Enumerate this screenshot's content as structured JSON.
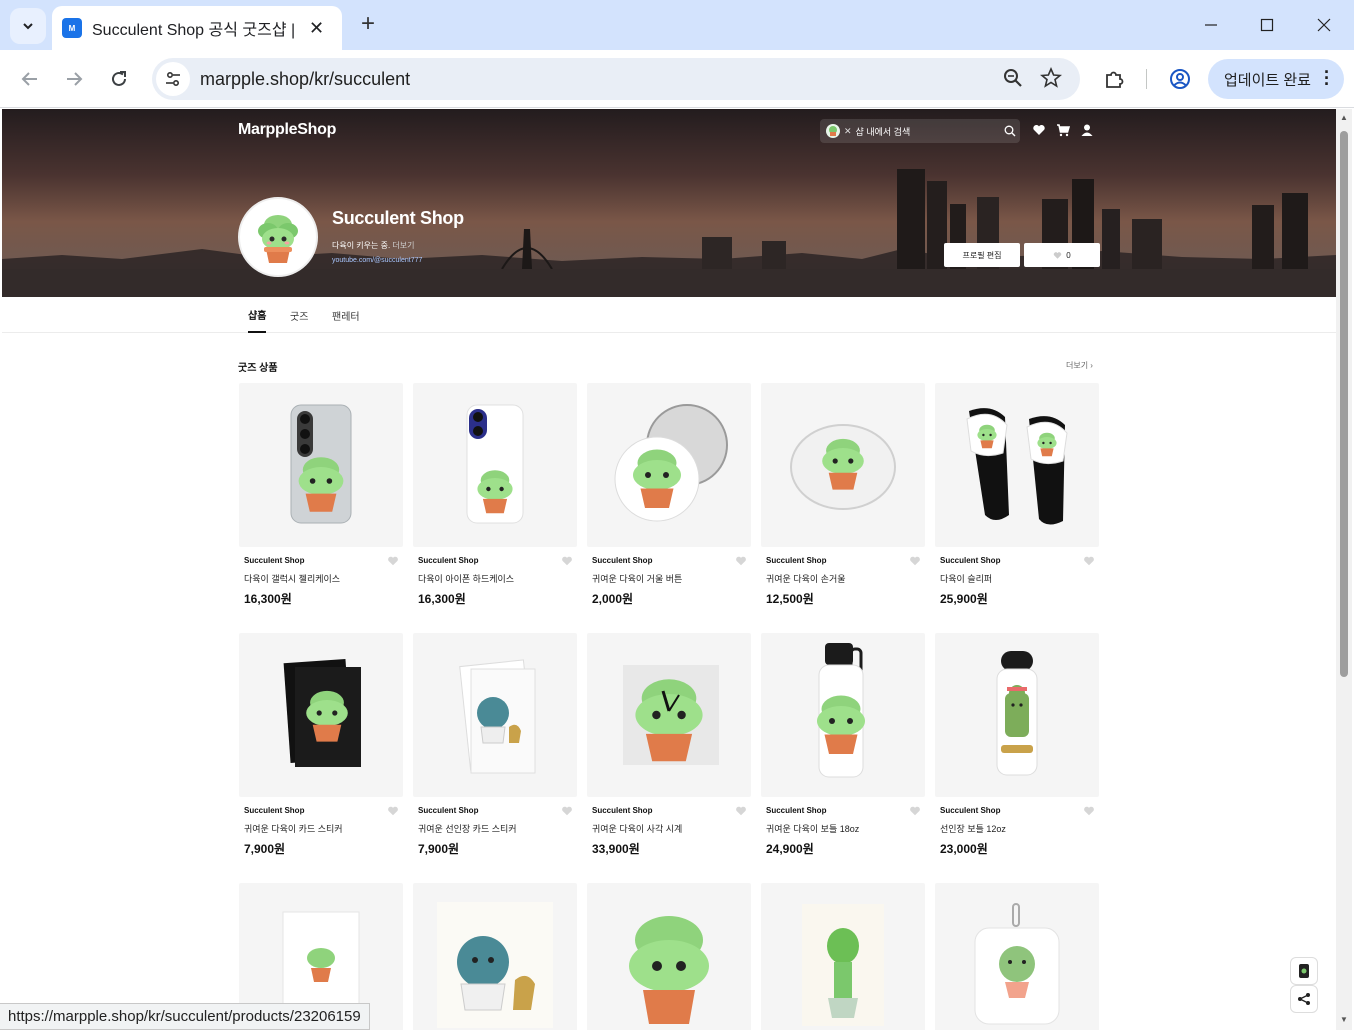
{
  "browser": {
    "tab_title": "Succulent Shop 공식 굿즈샵 | 마플샵",
    "favicon_text": "M",
    "url": "marpple.shop/kr/succulent",
    "update_label": "업데이트 완료",
    "status_url": "https://marpple.shop/kr/succulent/products/23206159"
  },
  "header": {
    "brand": "MarppleShop",
    "search_placeholder": "샵 내에서 검색"
  },
  "profile": {
    "name": "Succulent Shop",
    "description": "다육이 키우는 중.",
    "more": "더보기",
    "link": "youtube.com/@succulent777",
    "edit_button": "프로필 편집",
    "like_count": "0"
  },
  "tabs": [
    {
      "label": "샵홈"
    },
    {
      "label": "굿즈"
    },
    {
      "label": "팬레터"
    }
  ],
  "section": {
    "title": "굿즈 상품",
    "more": "더보기 ›"
  },
  "products": [
    {
      "seller": "Succulent Shop",
      "name": "다육이 갤럭시 젤리케이스",
      "price": "16,300원",
      "icon": "phone-case-clear"
    },
    {
      "seller": "Succulent Shop",
      "name": "다육이 아이폰 하드케이스",
      "price": "16,300원",
      "icon": "phone-case-white"
    },
    {
      "seller": "Succulent Shop",
      "name": "귀여운 다육이 거울 버튼",
      "price": "2,000원",
      "icon": "mirror-button"
    },
    {
      "seller": "Succulent Shop",
      "name": "귀여운 다육이 손거울",
      "price": "12,500원",
      "icon": "hand-mirror"
    },
    {
      "seller": "Succulent Shop",
      "name": "다육이 슬리퍼",
      "price": "25,900원",
      "icon": "slippers"
    },
    {
      "seller": "Succulent Shop",
      "name": "귀여운 다육이 카드 스티커",
      "price": "7,900원",
      "icon": "card-sticker-black"
    },
    {
      "seller": "Succulent Shop",
      "name": "귀여운 선인장 카드 스티커",
      "price": "7,900원",
      "icon": "card-sticker-cactus"
    },
    {
      "seller": "Succulent Shop",
      "name": "귀여운 다육이 사각 시계",
      "price": "33,900원",
      "icon": "square-clock"
    },
    {
      "seller": "Succulent Shop",
      "name": "귀여운 다육이 보틀 18oz",
      "price": "24,900원",
      "icon": "bottle-18oz"
    },
    {
      "seller": "Succulent Shop",
      "name": "선인장 보틀 12oz",
      "price": "23,000원",
      "icon": "bottle-12oz"
    }
  ],
  "colors": {
    "accent_blue": "#1a73e8",
    "succulent_green": "#7bc86c",
    "pot_orange": "#e07b4a"
  }
}
